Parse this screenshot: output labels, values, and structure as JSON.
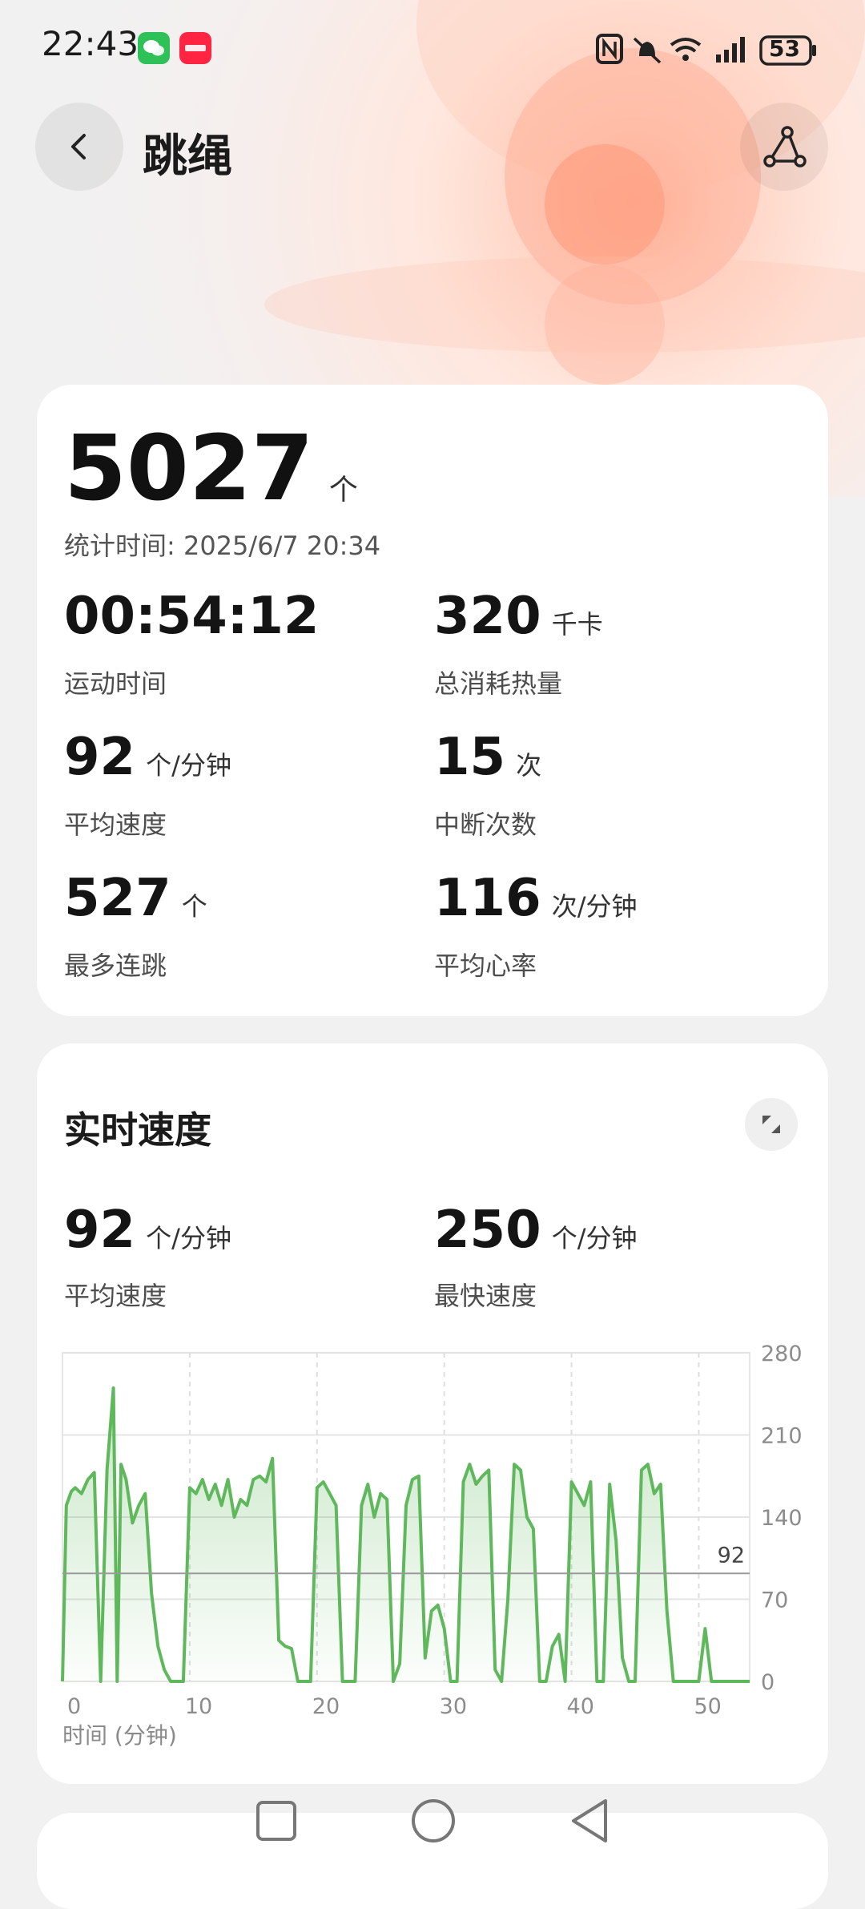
{
  "status_bar": {
    "time": "22:43",
    "battery": "53"
  },
  "header": {
    "title": "跳绳",
    "back_icon": "chevron-left-icon",
    "share_icon": "share-icon"
  },
  "summary": {
    "count": "5027",
    "count_unit": "个",
    "stat_time_label": "统计时间:",
    "stat_time": "2025/6/7 20:34",
    "items": [
      {
        "value": "00:54:12",
        "unit": "",
        "label": "运动时间"
      },
      {
        "value": "320",
        "unit": "千卡",
        "label": "总消耗热量"
      },
      {
        "value": "92",
        "unit": "个/分钟",
        "label": "平均速度"
      },
      {
        "value": "15",
        "unit": "次",
        "label": "中断次数"
      },
      {
        "value": "527",
        "unit": "个",
        "label": "最多连跳"
      },
      {
        "value": "116",
        "unit": "次/分钟",
        "label": "平均心率"
      }
    ]
  },
  "speed_card": {
    "title": "实时速度",
    "expand_icon": "expand-icon",
    "items": [
      {
        "value": "92",
        "unit": "个/分钟",
        "label": "平均速度"
      },
      {
        "value": "250",
        "unit": "个/分钟",
        "label": "最快速度"
      }
    ]
  },
  "chart_data": {
    "type": "area",
    "xlabel": "时间 (分钟)",
    "ylabel": "",
    "xlim": [
      0,
      54
    ],
    "ylim": [
      0,
      280
    ],
    "x_ticks": [
      0,
      10,
      20,
      30,
      40,
      50
    ],
    "y_ticks": [
      0,
      70,
      140,
      210,
      280
    ],
    "avg_line": 92,
    "avg_label": "92",
    "line_color": "#5fb85c",
    "x": [
      0,
      0.3,
      0.7,
      1,
      1.5,
      2,
      2.5,
      3,
      3.5,
      4,
      4.3,
      4.6,
      5,
      5.5,
      6,
      6.5,
      7,
      7.5,
      8,
      8.5,
      9,
      9.5,
      10,
      10.5,
      11,
      11.5,
      12,
      12.5,
      13,
      13.5,
      14,
      14.5,
      15,
      15.5,
      16,
      16.5,
      17,
      17.5,
      18,
      18.5,
      19,
      19.5,
      20,
      20.5,
      21,
      21.5,
      22,
      22.5,
      23,
      23.5,
      24,
      24.5,
      25,
      25.5,
      26,
      26.5,
      27,
      27.5,
      28,
      28.5,
      29,
      29.5,
      30,
      30.5,
      31,
      31.5,
      32,
      32.5,
      33,
      33.5,
      34,
      34.5,
      35,
      35.5,
      36,
      36.5,
      37,
      37.5,
      38,
      38.5,
      39,
      39.5,
      40,
      40.5,
      41,
      41.5,
      42,
      42.5,
      43,
      43.5,
      44,
      44.5,
      45,
      45.5,
      46,
      46.5,
      47,
      47.5,
      48,
      48.5,
      49,
      49.5,
      50,
      50.5,
      51,
      51.5,
      52,
      52.5,
      53,
      53.5,
      54
    ],
    "y": [
      0,
      150,
      162,
      165,
      160,
      172,
      178,
      0,
      180,
      250,
      0,
      185,
      172,
      135,
      150,
      160,
      75,
      30,
      10,
      0,
      0,
      0,
      165,
      160,
      172,
      155,
      168,
      150,
      172,
      140,
      155,
      150,
      172,
      175,
      170,
      190,
      35,
      30,
      28,
      0,
      0,
      0,
      165,
      170,
      160,
      150,
      0,
      0,
      0,
      150,
      168,
      140,
      160,
      155,
      0,
      15,
      150,
      172,
      175,
      20,
      60,
      65,
      45,
      0,
      0,
      170,
      185,
      168,
      175,
      180,
      10,
      0,
      70,
      185,
      180,
      140,
      130,
      0,
      0,
      30,
      40,
      0,
      170,
      160,
      150,
      170,
      0,
      0,
      168,
      120,
      20,
      0,
      0,
      180,
      185,
      160,
      168,
      60,
      0,
      0,
      0,
      0,
      0,
      45,
      0,
      0,
      0,
      0,
      0,
      0,
      0,
      20,
      0
    ]
  },
  "nav": {
    "recent_icon": "square-icon",
    "home_icon": "circle-icon",
    "back_icon": "triangle-back-icon"
  }
}
